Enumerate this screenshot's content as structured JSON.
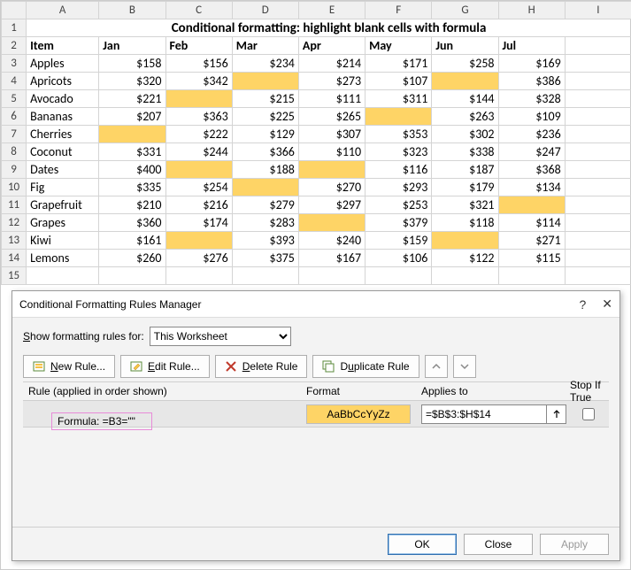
{
  "sheet": {
    "title": "Conditional formatting: highlight blank cells with formula",
    "col_letters": [
      "A",
      "B",
      "C",
      "D",
      "E",
      "F",
      "G",
      "H",
      "I"
    ],
    "item_header": "Item",
    "months": [
      "Jan",
      "Feb",
      "Mar",
      "Apr",
      "May",
      "Jun",
      "Jul"
    ],
    "rows": [
      {
        "n": 3,
        "item": "Apples",
        "v": [
          "$158",
          "$156",
          "$234",
          "$214",
          "$171",
          "$258",
          "$169"
        ]
      },
      {
        "n": 4,
        "item": "Apricots",
        "v": [
          "$320",
          "$342",
          "",
          "$273",
          "$107",
          "",
          "$386"
        ]
      },
      {
        "n": 5,
        "item": "Avocado",
        "v": [
          "$221",
          "",
          "$215",
          "$111",
          "$311",
          "$144",
          "$328"
        ]
      },
      {
        "n": 6,
        "item": "Bananas",
        "v": [
          "$207",
          "$363",
          "$225",
          "$265",
          "",
          "$263",
          "$109"
        ]
      },
      {
        "n": 7,
        "item": "Cherries",
        "v": [
          "",
          "$222",
          "$129",
          "$307",
          "$353",
          "$302",
          "$236"
        ]
      },
      {
        "n": 8,
        "item": "Coconut",
        "v": [
          "$331",
          "$244",
          "$366",
          "$110",
          "$323",
          "$338",
          "$247"
        ]
      },
      {
        "n": 9,
        "item": "Dates",
        "v": [
          "$400",
          "",
          "$188",
          "",
          "$116",
          "$187",
          "$368"
        ]
      },
      {
        "n": 10,
        "item": "Fig",
        "v": [
          "$335",
          "$254",
          "",
          "$270",
          "$293",
          "$179",
          "$134"
        ]
      },
      {
        "n": 11,
        "item": "Grapefruit",
        "v": [
          "$210",
          "$216",
          "$279",
          "$297",
          "$253",
          "$321",
          ""
        ]
      },
      {
        "n": 12,
        "item": "Grapes",
        "v": [
          "$360",
          "$174",
          "$283",
          "",
          "$379",
          "$118",
          "$114"
        ]
      },
      {
        "n": 13,
        "item": "Kiwi",
        "v": [
          "$161",
          "",
          "$393",
          "$240",
          "$159",
          "",
          "$271"
        ]
      },
      {
        "n": 14,
        "item": "Lemons",
        "v": [
          "$260",
          "$276",
          "$375",
          "$167",
          "$106",
          "$122",
          "$115"
        ]
      }
    ],
    "blank_row": 15
  },
  "dialog": {
    "title": "Conditional Formatting Rules Manager",
    "show_label_pre": "S",
    "show_label_post": "how formatting rules for:",
    "scope_value": "This Worksheet",
    "buttons": {
      "new": "New Rule...",
      "edit": "Edit Rule...",
      "delete": "Delete Rule",
      "duplicate": "Duplicate Rule"
    },
    "headers": {
      "rule": "Rule (applied in order shown)",
      "format": "Format",
      "applies": "Applies to",
      "stop": "Stop If True"
    },
    "rule": {
      "formula_text": "Formula: =B3=\"\"",
      "format_sample": "AaBbCcYyZz",
      "applies_to": "=$B$3:$H$14"
    },
    "footer": {
      "ok": "OK",
      "close": "Close",
      "apply": "Apply"
    }
  },
  "chart_data": {
    "type": "table",
    "title": "Conditional formatting: highlight blank cells with formula",
    "columns": [
      "Item",
      "Jan",
      "Feb",
      "Mar",
      "Apr",
      "May",
      "Jun",
      "Jul"
    ],
    "rows": [
      [
        "Apples",
        158,
        156,
        234,
        214,
        171,
        258,
        169
      ],
      [
        "Apricots",
        320,
        342,
        null,
        273,
        107,
        null,
        386
      ],
      [
        "Avocado",
        221,
        null,
        215,
        111,
        311,
        144,
        328
      ],
      [
        "Bananas",
        207,
        363,
        225,
        265,
        null,
        263,
        109
      ],
      [
        "Cherries",
        null,
        222,
        129,
        307,
        353,
        302,
        236
      ],
      [
        "Coconut",
        331,
        244,
        366,
        110,
        323,
        338,
        247
      ],
      [
        "Dates",
        400,
        null,
        188,
        null,
        116,
        187,
        368
      ],
      [
        "Fig",
        335,
        254,
        null,
        270,
        293,
        179,
        134
      ],
      [
        "Grapefruit",
        210,
        216,
        279,
        297,
        253,
        321,
        null
      ],
      [
        "Grapes",
        360,
        174,
        283,
        null,
        379,
        118,
        114
      ],
      [
        "Kiwi",
        161,
        null,
        393,
        240,
        159,
        null,
        271
      ],
      [
        "Lemons",
        260,
        276,
        375,
        167,
        106,
        122,
        115
      ]
    ],
    "currency_prefix": "$",
    "highlight_rule": "blank cells highlighted via formula =B3=\"\" over =$B$3:$H$14"
  }
}
